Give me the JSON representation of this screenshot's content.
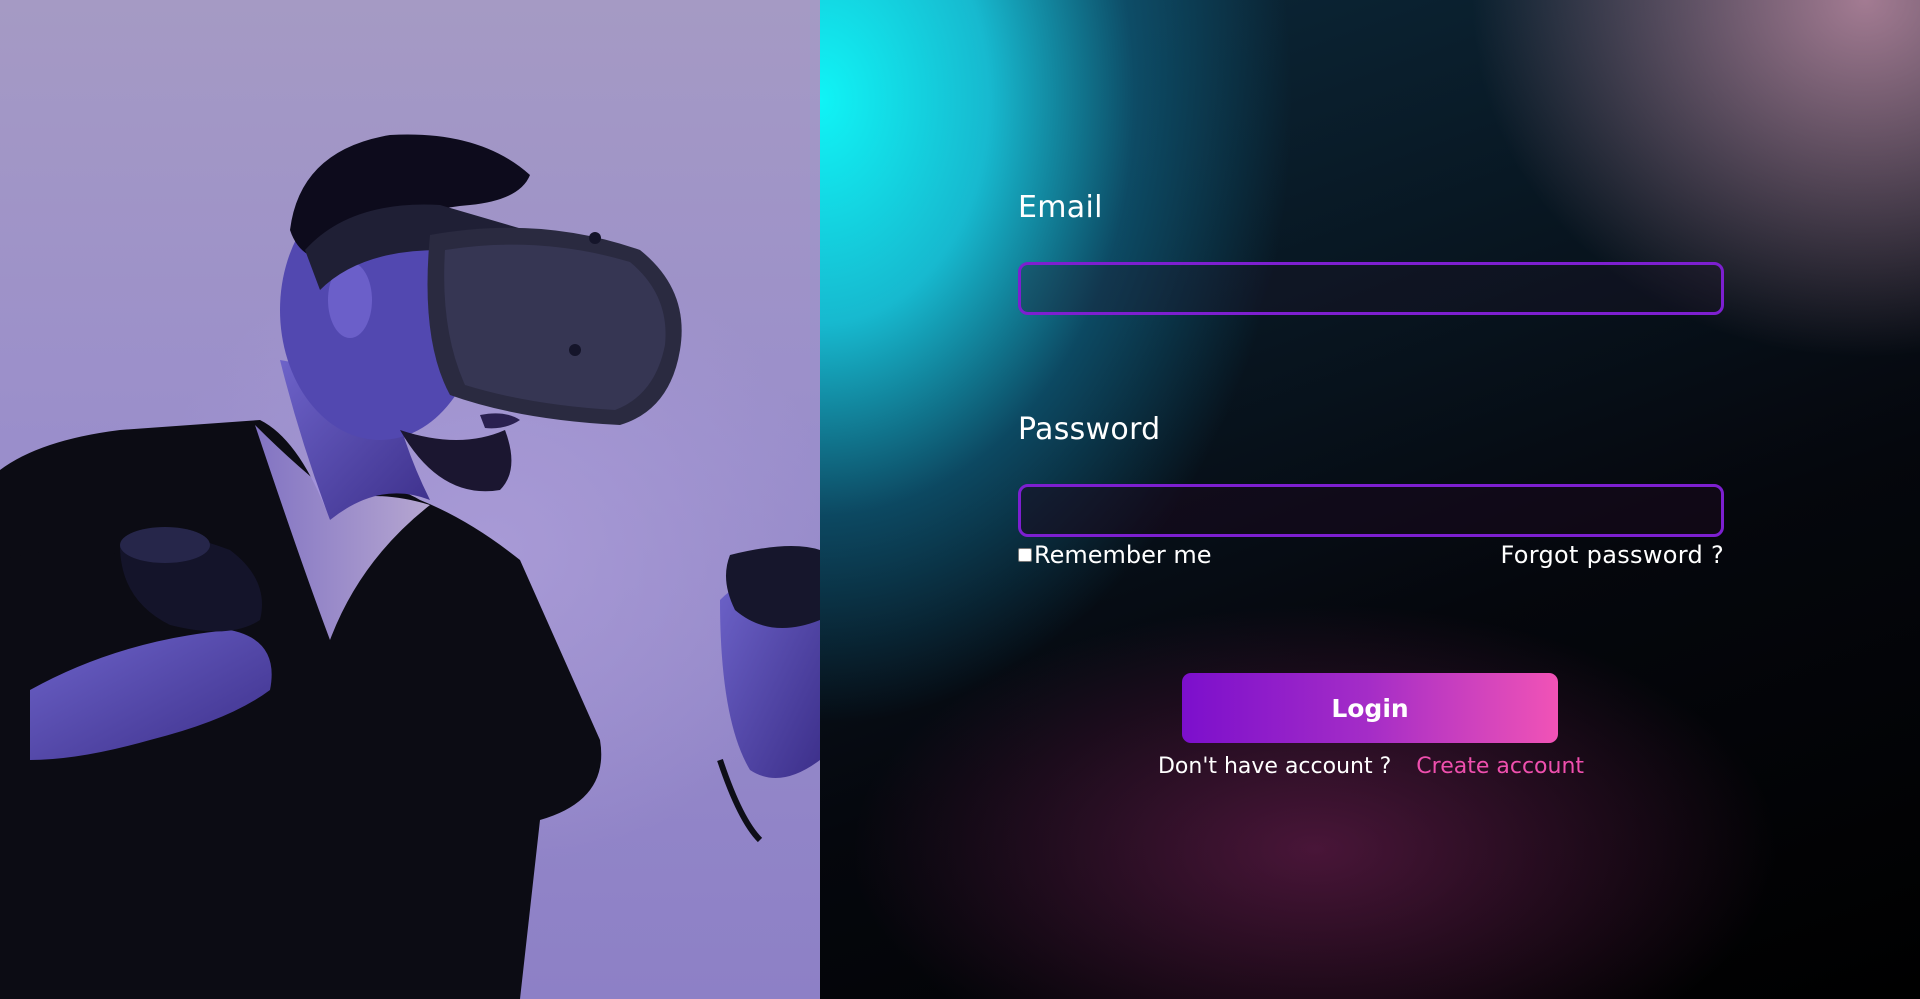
{
  "login_form": {
    "email_label": "Email",
    "email_value": "",
    "password_label": "Password",
    "password_value": "",
    "remember_label": "Remember me",
    "remember_checked": false,
    "forgot_label": "Forgot password ?",
    "login_label": "Login",
    "no_account_text": "Don't have account ?",
    "create_account_label": "Create account"
  },
  "colors": {
    "input_border": "#7d1fd0",
    "button_gradient_start": "#7c0fcc",
    "button_gradient_end": "#f153b6",
    "link": "#ef4fae"
  },
  "hero": {
    "subject": "person-wearing-vr-headset-with-controllers"
  }
}
